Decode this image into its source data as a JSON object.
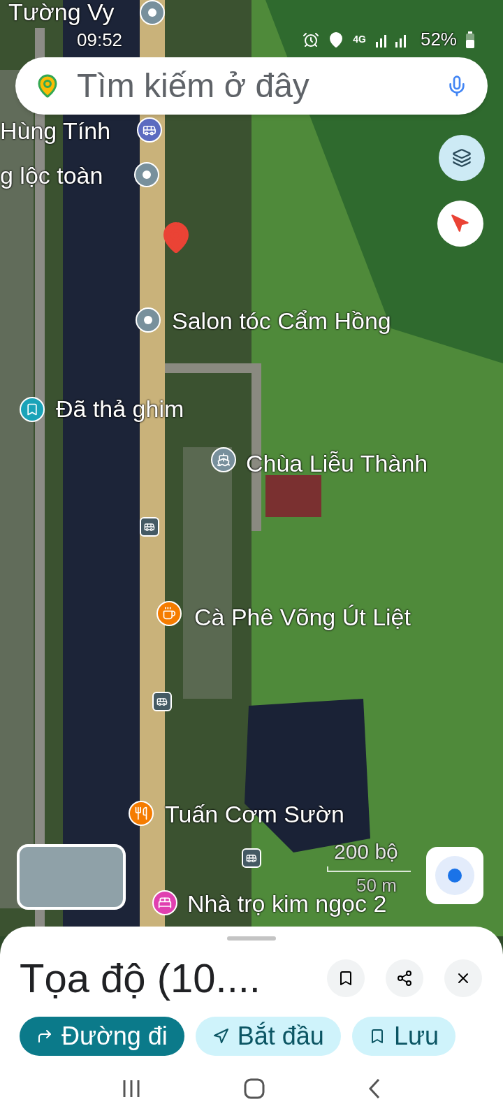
{
  "status_bar": {
    "time": "09:52",
    "network": "4G",
    "battery": "52%"
  },
  "search": {
    "placeholder": "Tìm kiếm ở đây"
  },
  "map": {
    "labels": [
      {
        "text": "Tường Vy",
        "kind": "place",
        "color": "#78909c"
      },
      {
        "text": "Hùng Tính",
        "kind": "bus",
        "color": "#5c6bc0"
      },
      {
        "text": "g lộc toàn",
        "kind": "place",
        "color": "#78909c"
      },
      {
        "text": "Salon tóc Cẩm Hồng",
        "kind": "place",
        "color": "#78909c"
      },
      {
        "text": "Đã thả ghim",
        "kind": "saved",
        "color": "#1aa3b8"
      },
      {
        "text": "Chùa Liễu Thành",
        "kind": "temple",
        "color": "#78909c"
      },
      {
        "text": "Cà Phê Võng Út Liệt",
        "kind": "cafe",
        "color": "#f57c00"
      },
      {
        "text": "Tuấn Cơm Sườn",
        "kind": "food",
        "color": "#f57c00"
      },
      {
        "text": "Nhà trọ kim ngọc 2",
        "kind": "hotel",
        "color": "#e040b0"
      }
    ],
    "scale": {
      "imperial": "200 bộ",
      "metric": "50 m"
    }
  },
  "sheet": {
    "title": "Tọa độ (10....",
    "actions": [
      {
        "label": "Đường đi",
        "kind": "directions",
        "selected": true
      },
      {
        "label": "Bắt đầu",
        "kind": "start",
        "selected": false
      },
      {
        "label": "Lưu",
        "kind": "save",
        "selected": false
      }
    ]
  }
}
